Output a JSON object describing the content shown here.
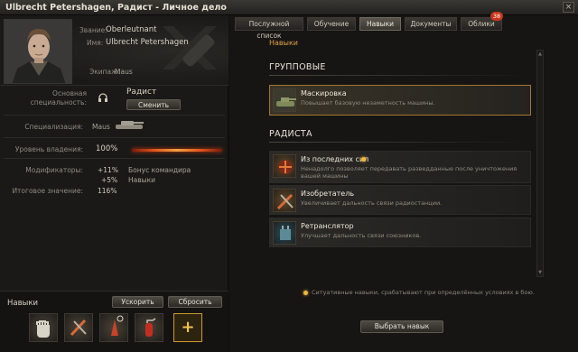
{
  "window": {
    "title": "Ulbrecht Petershagen, Радист - Личное дело",
    "close_label": "×"
  },
  "profile": {
    "rank_label": "Звание:",
    "rank": "Oberleutnant",
    "name_label": "Имя:",
    "name": "Ulbrecht Petershagen",
    "crew_label": "Экипаж:",
    "crew": "Maus"
  },
  "specialty": {
    "main_label_1": "Основная",
    "main_label_2": "специальность:",
    "role": "Радист",
    "change_button": "Сменить",
    "spec_label": "Специализация:",
    "spec_tank": "Maus",
    "mastery_label": "Уровень владения:",
    "mastery_value": "100%",
    "mastery_fraction": 1.0,
    "modifiers_label": "Модификаторы:",
    "mod1_value": "+11%",
    "mod1_name": "Бонус командира",
    "mod2_value": "+5%",
    "mod2_name": "Навыки",
    "total_label": "Итоговое значение:",
    "total_value": "116%"
  },
  "skills_bar": {
    "caption": "Навыки",
    "accelerate_button": "Ускорить",
    "reset_button": "Сбросить",
    "slots": [
      "fist-icon",
      "wrench-antenna-icon",
      "radio-tower-icon",
      "fire-extinguisher-icon"
    ],
    "add_label": "+"
  },
  "tabs": [
    {
      "label": "Послужной список"
    },
    {
      "label": "Обучение"
    },
    {
      "label": "Навыки"
    },
    {
      "label": "Документы"
    },
    {
      "label": "Облики",
      "badge": "38"
    }
  ],
  "active_tab": "Навыки",
  "skills_panel": {
    "breadcrumb": "Навыки",
    "group_title": "ГРУППОВЫЕ",
    "group_skills": [
      {
        "name": "Маскировка",
        "desc": "Повышает базовую незаметность машины.",
        "icon": "camouflage-tank-icon"
      }
    ],
    "radio_title": "РАДИСТА",
    "radio_skills": [
      {
        "name": "Из последних сил",
        "desc": "Ненадолго позволяет передавать разведданные после уничтожения вашей машины",
        "icon": "last-effort-icon"
      },
      {
        "name": "Изобретатель",
        "desc": "Увеличивает дальность связи радиостанции.",
        "icon": "inventor-icon"
      },
      {
        "name": "Ретранслятор",
        "desc": "Улучшает дальность связи союзников.",
        "icon": "relay-icon"
      }
    ],
    "footnote": "Ситуативные навыки, срабатывают при определённых условиях в бою.",
    "choose_button": "Выбрать навык"
  },
  "colors": {
    "accent": "#e0a14a",
    "selected_border": "#a1762f",
    "badge": "#c7351b",
    "mastery_bar": "#e2571c"
  }
}
